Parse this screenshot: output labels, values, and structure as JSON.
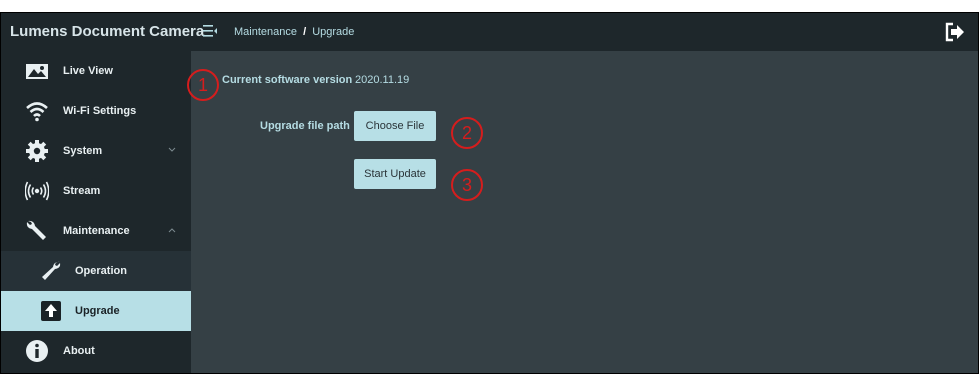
{
  "app": {
    "title": "Lumens Document Camera"
  },
  "breadcrumb": {
    "parent": "Maintenance",
    "separator": "/",
    "current": "Upgrade"
  },
  "sidebar": {
    "items": [
      {
        "label": "Live View",
        "icon": "image-icon"
      },
      {
        "label": "Wi-Fi Settings",
        "icon": "wifi-icon"
      },
      {
        "label": "System",
        "icon": "gear-icon",
        "chevron": "down"
      },
      {
        "label": "Stream",
        "icon": "broadcast-icon"
      },
      {
        "label": "Maintenance",
        "icon": "wrench-icon",
        "chevron": "up"
      },
      {
        "label": "Operation",
        "icon": "wrench-icon",
        "sub": true
      },
      {
        "label": "Upgrade",
        "icon": "upload-icon",
        "sub": true,
        "active": true
      },
      {
        "label": "About",
        "icon": "info-icon"
      }
    ]
  },
  "main": {
    "version_label": "Current software version",
    "version_value": "2020.11.19",
    "file_path_label": "Upgrade file path",
    "choose_file_label": "Choose File",
    "start_update_label": "Start Update"
  },
  "annotations": {
    "one": "1",
    "two": "2",
    "three": "3"
  },
  "colors": {
    "sidebar_bg": "#1e272b",
    "content_bg": "#354045",
    "accent": "#b7dfe6",
    "annotation": "#d51d1d"
  }
}
